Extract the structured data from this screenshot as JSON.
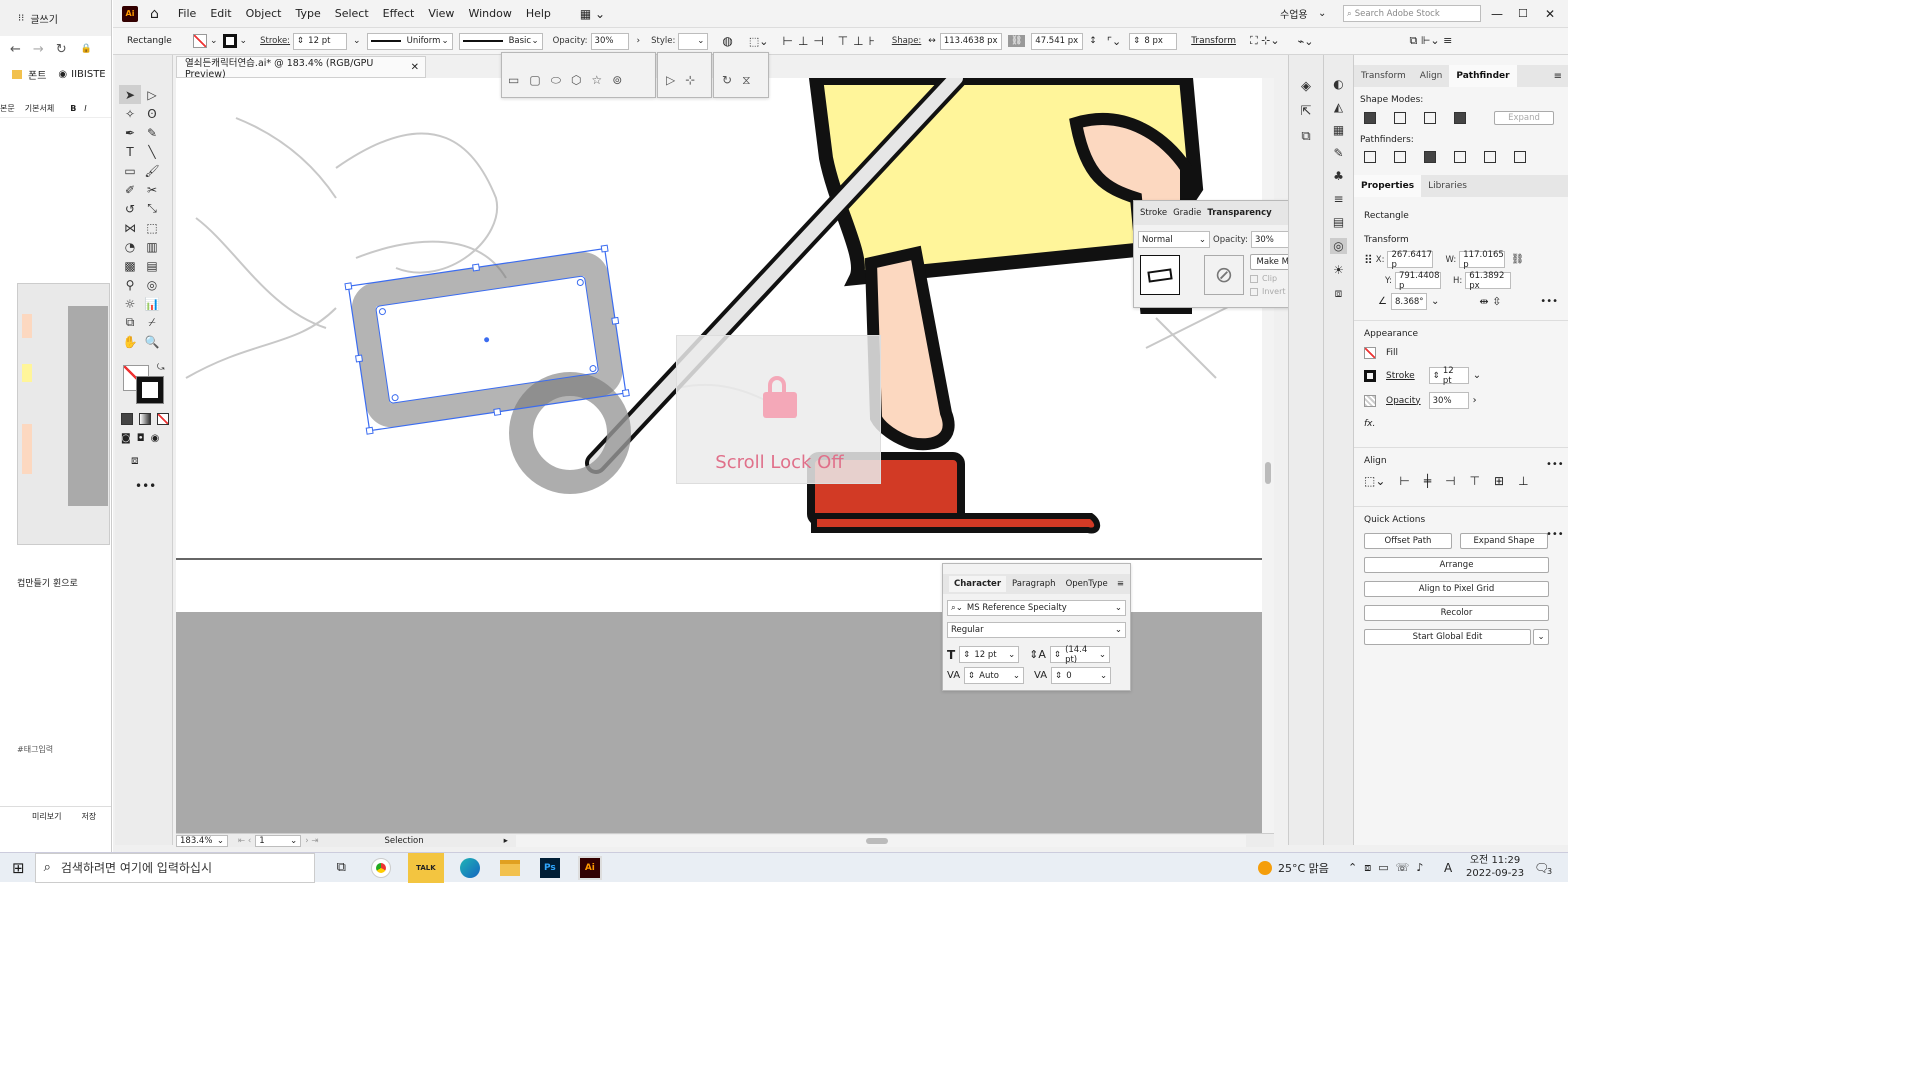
{
  "left_window": {
    "title": "글쓰기",
    "tab_font": "폰트",
    "tab_url": "IIBISTE",
    "fmt_label1": "본문",
    "fmt_label2": "기본서체",
    "bold": "B",
    "italic": "I",
    "text_line": "컵만들기 휜으로",
    "tag_input": "#태그입력",
    "preview": "미리보기",
    "save": "저장"
  },
  "ai": {
    "logo": "Ai",
    "menu": [
      "File",
      "Edit",
      "Object",
      "Type",
      "Select",
      "Effect",
      "View",
      "Window",
      "Help"
    ],
    "workspace": "수업용",
    "search_placeholder": "Search Adobe Stock",
    "control": {
      "object_type": "Rectangle",
      "stroke_label": "Stroke:",
      "stroke_value": "12 pt",
      "uniform": "Uniform",
      "basic": "Basic",
      "opacity_label": "Opacity:",
      "opacity_value": "30%",
      "style_label": "Style:",
      "shape_label": "Shape:",
      "shape_w": "113.4638 px",
      "shape_h": "47.541 px",
      "corner": "8 px",
      "transform": "Transform"
    },
    "doc_tab": "열쇠든캐릭터연습.ai* @ 183.4% (RGB/GPU Preview)",
    "status": {
      "zoom": "183.4%",
      "artboard": "1",
      "mode": "Selection"
    },
    "scroll_lock": "Scroll Lock Off",
    "transparency_panel": {
      "tabs": [
        "Stroke",
        "Gradie",
        "Transparency"
      ],
      "blend": "Normal",
      "opacity_label": "Opacity:",
      "opacity": "30%",
      "make_mask": "Make Mask",
      "clip": "Clip",
      "invert": "Invert Mask"
    },
    "character_panel": {
      "tabs": [
        "Character",
        "Paragraph",
        "OpenType"
      ],
      "font": "MS Reference Specialty",
      "style": "Regular",
      "size": "12 pt",
      "leading": "(14.4 pt)",
      "kerning": "Auto",
      "tracking": "0"
    },
    "right_panel": {
      "top_tabs": [
        "Transform",
        "Align",
        "Pathfinder"
      ],
      "shape_modes": "Shape Modes:",
      "expand": "Expand",
      "pathfinders": "Pathfinders:",
      "tabs": [
        "Properties",
        "Libraries"
      ],
      "object": "Rectangle",
      "transform_title": "Transform",
      "x_label": "X:",
      "x": "267.6417 p",
      "y_label": "Y:",
      "y": "791.4408 p",
      "w_label": "W:",
      "w": "117.0165 p",
      "h_label": "H:",
      "h": "61.3892 px",
      "angle": "8.368°",
      "appearance": "Appearance",
      "fill": "Fill",
      "stroke": "Stroke",
      "stroke_val": "12 pt",
      "opacity": "Opacity",
      "opacity_val": "30%",
      "fx": "fx.",
      "align": "Align",
      "quick_actions": "Quick Actions",
      "offset_path": "Offset Path",
      "expand_shape": "Expand Shape",
      "arrange": "Arrange",
      "align_pixel": "Align to Pixel Grid",
      "recolor": "Recolor",
      "global_edit": "Start Global Edit"
    }
  },
  "taskbar": {
    "search": "검색하려면 여기에 입력하십시",
    "weather": "25°C 맑음",
    "ime": "A",
    "time": "오전 11:29",
    "date": "2022-09-23",
    "notif": "3",
    "kakao": "TALK",
    "ps": "Ps",
    "ai": "Ai"
  },
  "colors": {
    "ai_brand": "#ff7c00",
    "shirt": "#fff59a",
    "skin": "#fcd8c0",
    "shoe": "#d23a25",
    "selection": "#3b6cf0",
    "scroll_lock_text": "#e0708a"
  }
}
